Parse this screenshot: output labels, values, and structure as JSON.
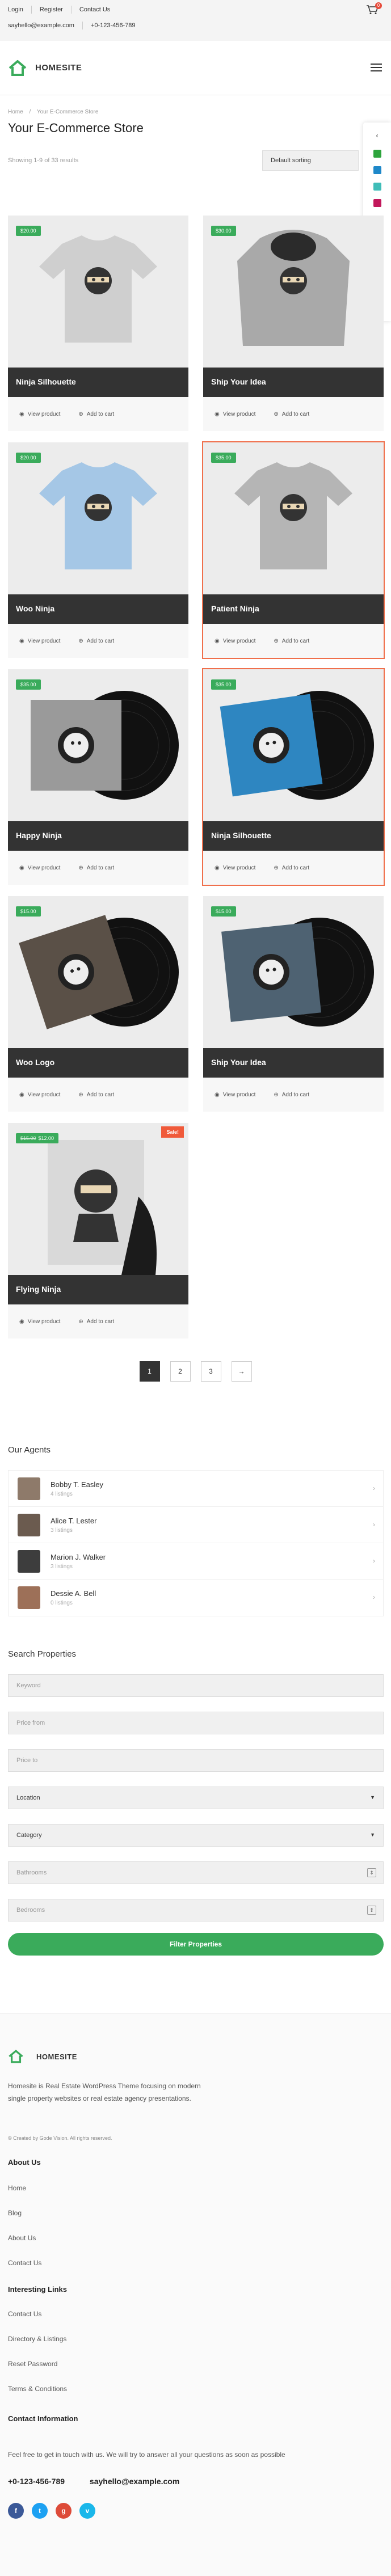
{
  "topbar": {
    "links": [
      "Login",
      "Register",
      "Contact Us"
    ],
    "email": "sayhello@example.com",
    "phone": "+0-123-456-789",
    "cart_count": "0"
  },
  "header": {
    "logo": "HOMESITE"
  },
  "breadcrumb": [
    "Home",
    "/",
    "Your E-Commerce Store"
  ],
  "page_title": "Your E-Commerce Store",
  "results_text": "Showing 1-9 of 33 results",
  "sorting": "Default sorting",
  "swatch_colors": [
    "#2da43c",
    "#1e88c9",
    "#3fbdb8",
    "#c2185b",
    "#c62828",
    "#f25a3c",
    "#455a64",
    "#3a3a3a",
    "#222222"
  ],
  "products": [
    {
      "name": "Ninja Silhouette",
      "price": "$20.00",
      "view": "View product",
      "cart": "Add to cart"
    },
    {
      "name": "Ship Your Idea",
      "price": "$30.00",
      "view": "View product",
      "cart": "Add to cart"
    },
    {
      "name": "Woo Ninja",
      "price": "$20.00",
      "view": "View product",
      "cart": "Add to cart"
    },
    {
      "name": "Patient Ninja",
      "price": "$35.00",
      "view": "View product",
      "cart": "Add to cart"
    },
    {
      "name": "Happy Ninja",
      "price": "$35.00",
      "view": "View product",
      "cart": "Add to cart"
    },
    {
      "name": "Ninja Silhouette",
      "price": "$35.00",
      "view": "View product",
      "cart": "Add to cart"
    },
    {
      "name": "Woo Logo",
      "price": "$15.00",
      "view": "View product",
      "cart": "Add to cart"
    },
    {
      "name": "Ship Your Idea",
      "price": "$15.00",
      "view": "View product",
      "cart": "Add to cart"
    },
    {
      "name": "Flying Ninja",
      "old_price": "$15.00",
      "price": "$12.00",
      "sale": "Sale!",
      "view": "View product",
      "cart": "Add to cart"
    }
  ],
  "pagination": [
    "1",
    "2",
    "3",
    "→"
  ],
  "agents_title": "Our Agents",
  "agents": [
    {
      "name": "Bobby T. Easley",
      "listings": "4 listings"
    },
    {
      "name": "Alice T. Lester",
      "listings": "3 listings"
    },
    {
      "name": "Marion J. Walker",
      "listings": "3 listings"
    },
    {
      "name": "Dessie A. Bell",
      "listings": "0 listings"
    }
  ],
  "search_title": "Search Properties",
  "search": {
    "keyword": "Keyword",
    "price_from": "Price from",
    "price_to": "Price to",
    "location": "Location",
    "category": "Category",
    "bathrooms": "Bathrooms",
    "bedrooms": "Bedrooms",
    "button": "Filter Properties"
  },
  "footer": {
    "logo": "HOMESITE",
    "description": "Homesite is Real Estate WordPress Theme focusing on modern single property websites or real estate agency presentations.",
    "credit": "© Created by Gode Vision. All rights reserved.",
    "about_title": "About Us",
    "about_links": [
      "Home",
      "Blog",
      "About Us",
      "Contact Us"
    ],
    "interesting_title": "Interesting Links",
    "interesting_links": [
      "Contact Us",
      "Directory & Listings",
      "Reset Password",
      "Terms & Conditions"
    ],
    "contact_title": "Contact Information",
    "contact_text": "Feel free to get in touch with us. We will try to answer all your questions as soon as possible",
    "phone": "+0-123-456-789",
    "email": "sayhello@example.com",
    "social": [
      "f",
      "t",
      "g",
      "v"
    ],
    "social_colors": [
      "#3b5998",
      "#1da1f2",
      "#dd4b39",
      "#1ab7ea"
    ]
  }
}
